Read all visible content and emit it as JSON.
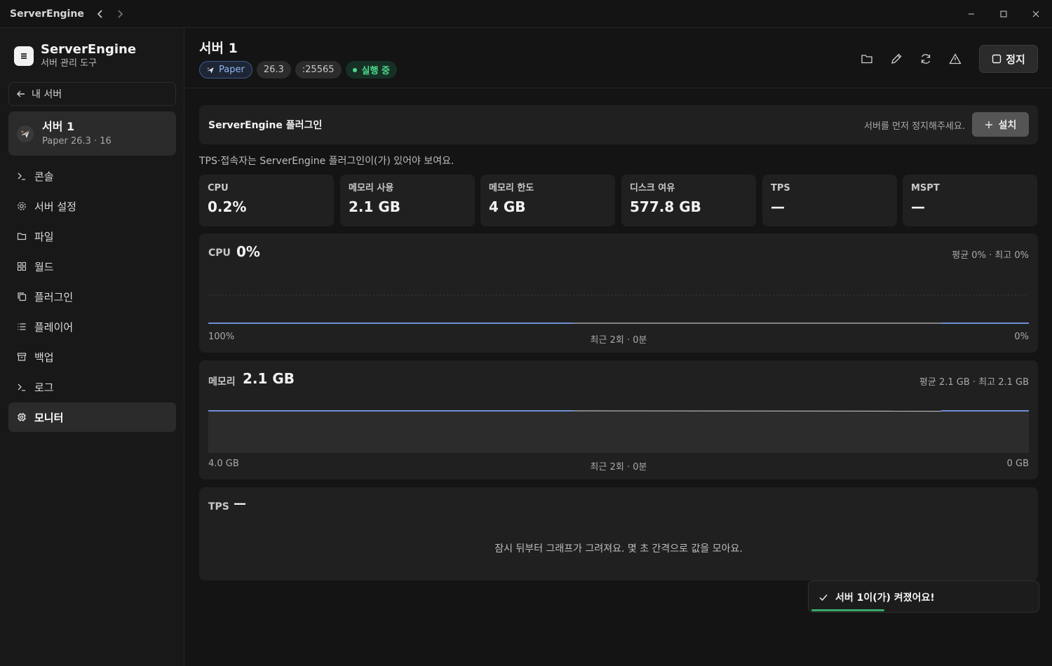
{
  "app": {
    "title": "ServerEngine"
  },
  "sidebar": {
    "brand_title": "ServerEngine",
    "brand_subtitle": "서버 관리 도구",
    "back_label": "내 서버",
    "server": {
      "name": "서버 1",
      "meta": "Paper 26.3 · 16"
    },
    "items": [
      {
        "label": "콘솔",
        "icon": "terminal-icon"
      },
      {
        "label": "서버 설정",
        "icon": "gear-icon"
      },
      {
        "label": "파일",
        "icon": "folder-icon"
      },
      {
        "label": "월드",
        "icon": "grid-icon"
      },
      {
        "label": "플러그인",
        "icon": "copy-icon"
      },
      {
        "label": "플레이어",
        "icon": "list-icon"
      },
      {
        "label": "백업",
        "icon": "archive-icon"
      },
      {
        "label": "로그",
        "icon": "terminal-icon"
      },
      {
        "label": "모니터",
        "icon": "chip-icon",
        "active": true
      }
    ]
  },
  "header": {
    "title": "서버 1",
    "badges": {
      "software": "Paper",
      "version": "26.3",
      "port": ":25565",
      "status": "실행 중"
    },
    "stop_label": "정지"
  },
  "plugin": {
    "title": "ServerEngine 플러그인",
    "hint": "서버를 먼저 정지해주세요.",
    "install_label": "설치",
    "notice": "TPS·접속자는 ServerEngine 플러그인이(가) 있어야 보여요."
  },
  "stats": [
    {
      "label": "CPU",
      "value": "0.2%"
    },
    {
      "label": "메모리 사용",
      "value": "2.1 GB"
    },
    {
      "label": "메모리 한도",
      "value": "4 GB"
    },
    {
      "label": "디스크 여유",
      "value": "577.8 GB"
    },
    {
      "label": "TPS",
      "value": "—"
    },
    {
      "label": "MSPT",
      "value": "—"
    }
  ],
  "cpu_graph": {
    "label": "CPU",
    "value": "0%",
    "summary": "평균 0% · 최고 0%",
    "max_label": "100%",
    "window_label": "최근 2회 · 0분",
    "min_label": "0%",
    "level": 0.0
  },
  "memory_graph": {
    "label": "메모리",
    "value": "2.1 GB",
    "summary": "평균 2.1 GB · 최고 2.1 GB",
    "max_label": "4.0 GB",
    "window_label": "최근 2회 · 0분",
    "min_label": "0 GB",
    "level": 0.525
  },
  "tps_graph": {
    "label": "TPS",
    "value": "—",
    "empty_message": "잠시 뒤부터 그래프가 그려져요. 몇 초 간격으로 값을 모아요."
  },
  "toast": {
    "message": "서버 1이(가) 켜졌어요!"
  },
  "colors": {
    "accent_line": "#6f8fd8",
    "running": "#4cd98b",
    "toast_bar": "#3aa96c"
  }
}
